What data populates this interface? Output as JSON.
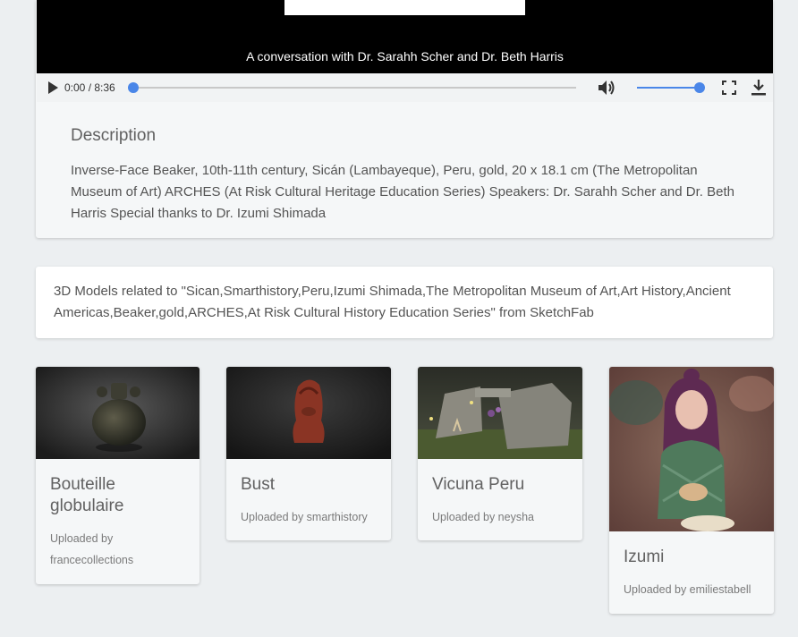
{
  "video": {
    "caption": "A conversation with Dr. Sarahh Scher and Dr. Beth Harris",
    "time": "0:00 / 8:36",
    "progress": 0,
    "volume": 1.0
  },
  "description": {
    "title": "Description",
    "body": "Inverse-Face Beaker, 10th-11th century, Sicán (Lambayeque), Peru, gold, 20 x 18.1 cm (The Metropolitan Museum of Art) ARCHES (At Risk Cultural Heritage Education Series) Speakers: Dr. Sarahh Scher and Dr. Beth Harris Special thanks to Dr. Izumi Shimada"
  },
  "related": {
    "text": "3D Models related to \"Sican,Smarthistory,Peru,Izumi Shimada,The Metropolitan Museum of Art,Art History,Ancient Americas,Beaker,gold,ARCHES,At Risk Cultural History Education Series\" from SketchFab"
  },
  "models": [
    {
      "title": "Bouteille globulaire",
      "uploader": "Uploaded by francecollections"
    },
    {
      "title": "Bust",
      "uploader": "Uploaded by smarthistory"
    },
    {
      "title": "Vicuna Peru",
      "uploader": "Uploaded by neysha"
    },
    {
      "title": "Izumi",
      "uploader": "Uploaded by emiliestabell"
    }
  ],
  "colors": {
    "accent": "#4a86e8",
    "background": "#eceff1",
    "card": "#f5f7f8"
  }
}
